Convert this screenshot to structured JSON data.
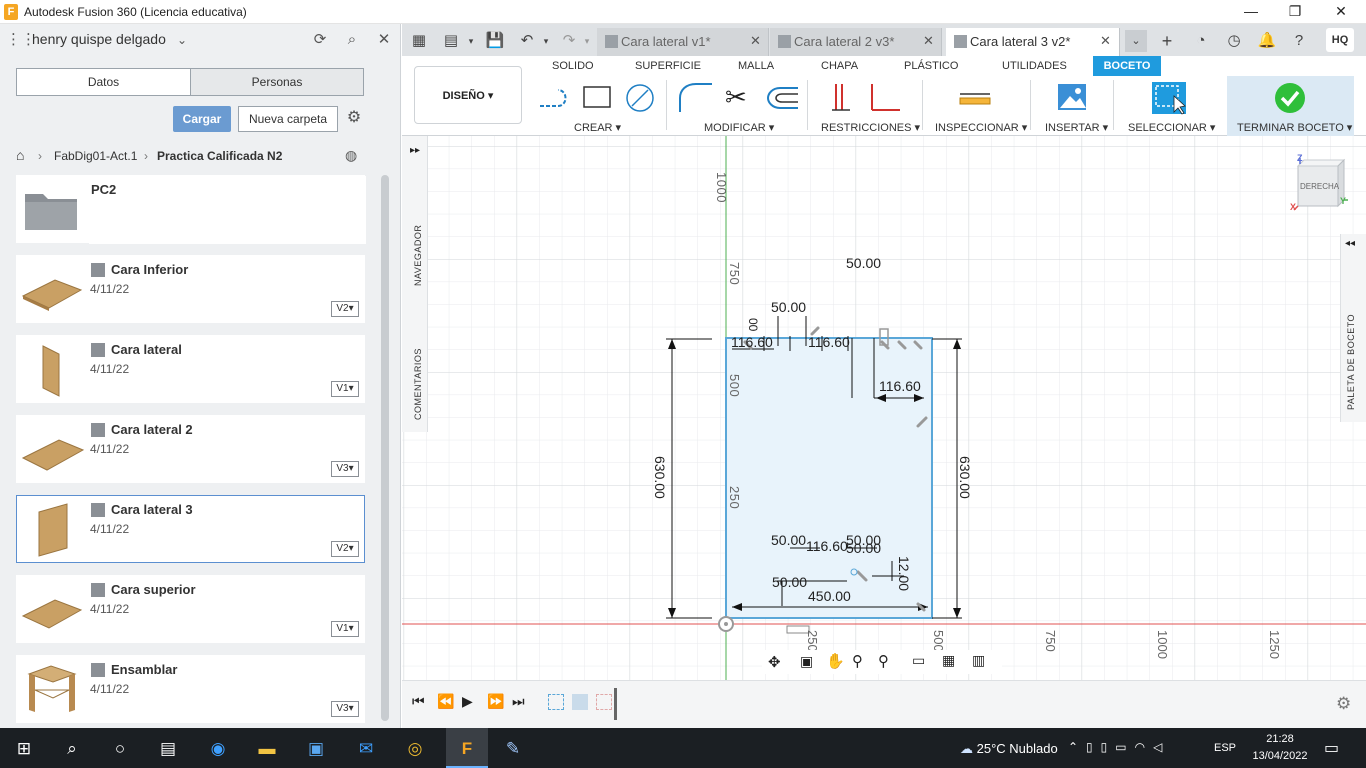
{
  "window": {
    "title": "Autodesk Fusion 360 (Licencia educativa)",
    "logo_letter": "F",
    "minimize": "—",
    "maximize": "❐",
    "close": "✕"
  },
  "data_panel": {
    "user": "henry quispe delgado",
    "tabs": [
      "Datos",
      "Personas"
    ],
    "upload_label": "Cargar",
    "new_folder_label": "Nueva carpeta",
    "breadcrumb": [
      "FabDig01-Act.1",
      "Practica Calificada N2"
    ],
    "folder": {
      "name": "PC2"
    },
    "items": [
      {
        "name": "Cara Inferior",
        "date": "4/11/22",
        "version": "V2"
      },
      {
        "name": "Cara lateral",
        "date": "4/11/22",
        "version": "V1"
      },
      {
        "name": "Cara lateral 2",
        "date": "4/11/22",
        "version": "V3"
      },
      {
        "name": "Cara lateral 3",
        "date": "4/11/22",
        "version": "V2"
      },
      {
        "name": "Cara superior",
        "date": "4/11/22",
        "version": "V1"
      },
      {
        "name": "Ensamblar",
        "date": "4/11/22",
        "version": "V3"
      }
    ]
  },
  "doc_tabs": [
    {
      "label": "Cara lateral v1*",
      "active": false
    },
    {
      "label": "Cara lateral 2 v3*",
      "active": false
    },
    {
      "label": "Cara lateral 3 v2*",
      "active": true
    }
  ],
  "user_initials": "HQ",
  "ribbon": {
    "tabs": [
      "SOLIDO",
      "SUPERFICIE",
      "MALLA",
      "CHAPA",
      "PLÁSTICO",
      "UTILIDADES",
      "BOCETO"
    ],
    "active_tab": "BOCETO",
    "workspace": "DISEÑO ▾",
    "groups": [
      "CREAR ▾",
      "MODIFICAR ▾",
      "RESTRICCIONES ▾",
      "INSPECCIONAR ▾",
      "INSERTAR ▾",
      "SELECCIONAR ▾",
      "TERMINAR BOCETO ▾"
    ]
  },
  "side_panels": {
    "navigator": "NAVEGADOR",
    "comments": "COMENTARIOS",
    "sketch_palette": "PALETA DE BOCETO",
    "expand_left": "▸▸",
    "expand_right": "◂◂"
  },
  "viewcube": {
    "face": "DERECHA",
    "z": "Z",
    "y": "Y",
    "x": "X"
  },
  "axis_labels": {
    "vertical": [
      "1000",
      "750",
      "500",
      "250"
    ],
    "horizontal": [
      "250",
      "500",
      "750",
      "1000",
      "1250"
    ]
  },
  "dimensions": [
    "50.00",
    "50.00",
    "00",
    "116.60",
    "116.60",
    "116.60",
    "630.00",
    "630.00",
    "50.00",
    "116.60",
    "50.00",
    "50.00",
    "12.00",
    "50.00",
    "450.00"
  ],
  "taskbar": {
    "weather": "25°C  Nublado",
    "lang": "ESP",
    "time": "21:28",
    "date": "13/04/2022"
  },
  "colors": {
    "accent": "#1f9bde",
    "sketch_fill": "#e8f3fb",
    "sketch_line": "#5aa7d8",
    "axis_green": "#4caf50",
    "axis_red": "#e05050",
    "finish_green": "#2fbf3a"
  }
}
